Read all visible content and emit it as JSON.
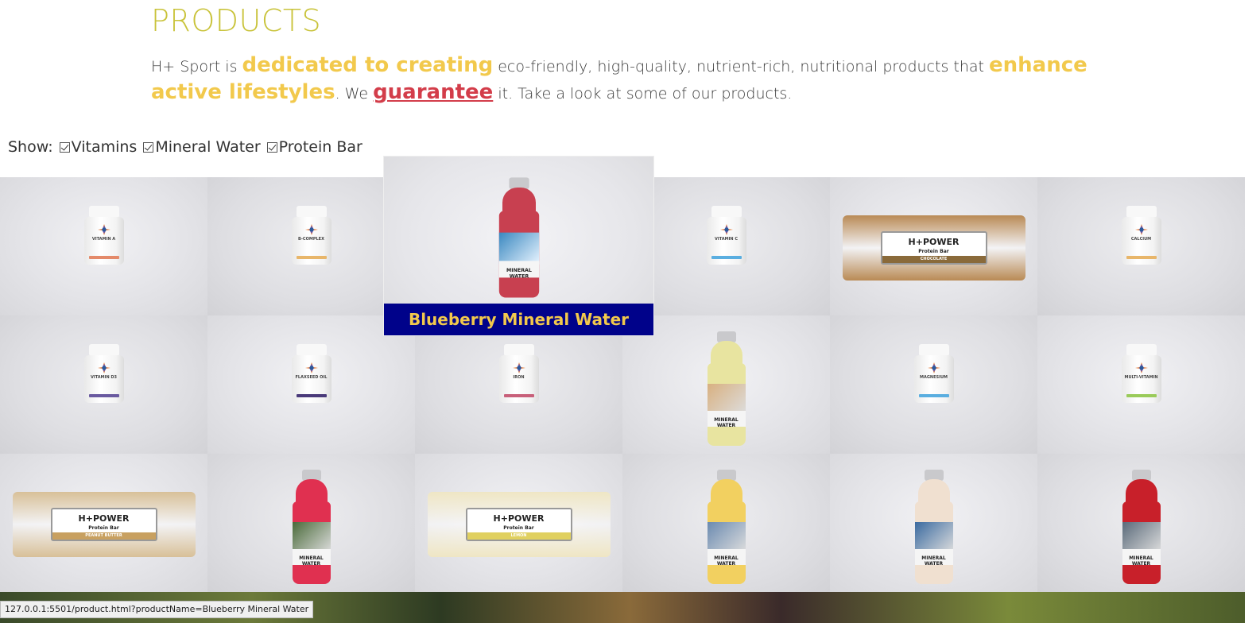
{
  "page": {
    "title": "PRODUCTS",
    "intro": {
      "p1": "H+ Sport is ",
      "hl1": "dedicated to creating",
      "p2": " eco-friendly, high-quality, nutrient-rich, nutritional products that ",
      "hl2": "enhance active lifestyles",
      "p3": ". We ",
      "guarantee": "guarantee",
      "p4": " it. Take a look at some of our products."
    }
  },
  "filters": {
    "label": "Show:",
    "options": [
      "Vitamins",
      "Mineral Water",
      "Protein Bar"
    ]
  },
  "products": [
    {
      "type": "vitamin",
      "name": "VITAMIN A",
      "band": "#e48a6a"
    },
    {
      "type": "vitamin",
      "name": "B-COMPLEX",
      "band": "#e8b66a"
    },
    {
      "type": "water",
      "name": "MINERAL WATER",
      "color": "#c8384a",
      "photo": "#4a90c0"
    },
    {
      "type": "vitamin",
      "name": "VITAMIN C",
      "band": "#5aaee0"
    },
    {
      "type": "bar",
      "name": "H+POWER",
      "sub": "Protein Bar",
      "flavor": "CHOCOLATE",
      "wrap": "#b98a55",
      "flavorColor": "#8a6a3a"
    },
    {
      "type": "vitamin",
      "name": "CALCIUM",
      "band": "#e8b66a"
    },
    {
      "type": "vitamin",
      "name": "VITAMIN D3",
      "band": "#6a5aa0"
    },
    {
      "type": "vitamin",
      "name": "FLAXSEED OIL",
      "band": "#4a3a7a"
    },
    {
      "type": "vitamin",
      "name": "IRON",
      "band": "#c8607a"
    },
    {
      "type": "water",
      "name": "MINERAL WATER",
      "color": "#e8e4a0",
      "photo": "#d8b080"
    },
    {
      "type": "vitamin",
      "name": "MAGNESIUM",
      "band": "#5aaee0"
    },
    {
      "type": "vitamin",
      "name": "MULTI-VITAMIN",
      "band": "#9acb5a"
    },
    {
      "type": "bar",
      "name": "H+POWER",
      "sub": "Protein Bar",
      "flavor": "PEANUT BUTTER",
      "wrap": "#d8c098",
      "flavorColor": "#c8a060"
    },
    {
      "type": "water",
      "name": "MINERAL WATER",
      "color": "#e03050",
      "photo": "#4a6a3a"
    },
    {
      "type": "bar",
      "name": "H+POWER",
      "sub": "Protein Bar",
      "flavor": "LEMON",
      "wrap": "#efe6c4",
      "flavorColor": "#e0d060"
    },
    {
      "type": "water",
      "name": "MINERAL WATER",
      "color": "#f2d060",
      "photo": "#6a8ab0"
    },
    {
      "type": "water",
      "name": "MINERAL WATER",
      "color": "#f0e0d0",
      "photo": "#3a6aa0"
    },
    {
      "type": "water",
      "name": "MINERAL WATER",
      "color": "#c8202a",
      "photo": "#5a6a7a"
    }
  ],
  "hover": {
    "caption": "Blueberry Mineral Water",
    "bottle_name": "MINERAL WATER",
    "color": "#c84050",
    "photo": "#3a88c0"
  },
  "status": {
    "url": "127.0.0.1:5501/product.html?productName=Blueberry Mineral Water"
  }
}
